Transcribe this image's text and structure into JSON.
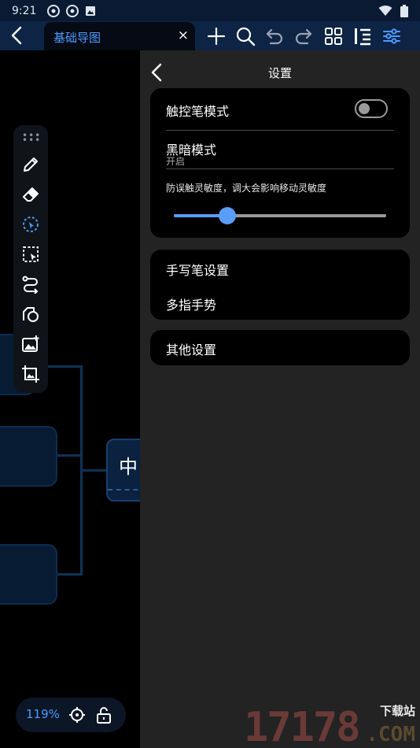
{
  "status_bar": {
    "time": "9:21"
  },
  "toolbar": {
    "tab_title": "基础导图",
    "tab_close": "×"
  },
  "canvas": {
    "center_node_text": "中",
    "zoom_level": "119%"
  },
  "settings": {
    "title": "设置",
    "stylus_mode": {
      "label": "触控笔模式",
      "enabled": false
    },
    "dark_mode": {
      "label": "黑暗模式",
      "value": "开启"
    },
    "sensitivity": {
      "description": "防误触灵敏度，调大会影响移动灵敏度",
      "value": 0.25
    },
    "stylus_settings": "手写笔设置",
    "multi_finger": "多指手势",
    "other_settings": "其他设置"
  },
  "watermark": {
    "big": "17178",
    "small": "下载站",
    "com": ".COM"
  },
  "colors": {
    "accent": "#5b9cf6",
    "tab_title": "#4c9bff",
    "toolbar_bg": "#0d2445",
    "panel_bg": "#232323"
  }
}
